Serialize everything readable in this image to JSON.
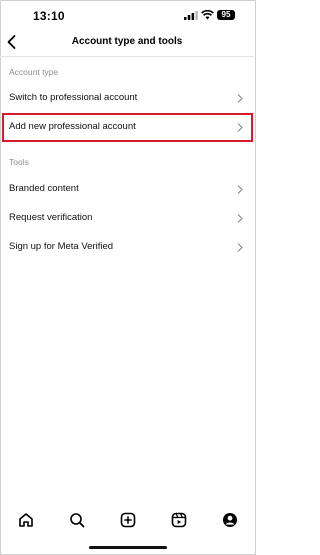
{
  "status_bar": {
    "time": "13:10",
    "battery": "95"
  },
  "header": {
    "title": "Account type and tools"
  },
  "sections": {
    "account_type": {
      "label": "Account type",
      "items": [
        {
          "label": "Switch to professional account"
        },
        {
          "label": "Add new professional account",
          "highlighted": true
        }
      ]
    },
    "tools": {
      "label": "Tools",
      "items": [
        {
          "label": "Branded content"
        },
        {
          "label": "Request verification"
        },
        {
          "label": "Sign up for Meta Verified"
        }
      ]
    }
  },
  "bottom_nav": {
    "items": [
      {
        "icon": "home-icon"
      },
      {
        "icon": "search-icon"
      },
      {
        "icon": "create-plus-icon"
      },
      {
        "icon": "reels-icon"
      },
      {
        "icon": "profile-icon"
      }
    ]
  },
  "colors": {
    "highlight_border": "#d81b2a",
    "section_label": "#8e8e8e",
    "chevron": "#8e8e8e"
  }
}
